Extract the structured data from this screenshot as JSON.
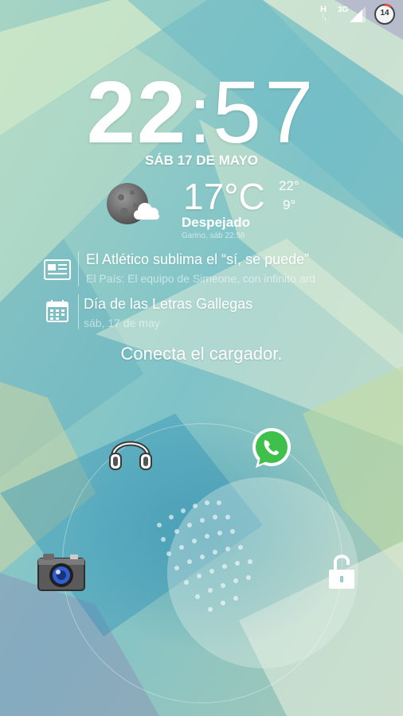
{
  "status_bar": {
    "network_type": "H",
    "mobile_data": "3G",
    "battery_level": "14"
  },
  "clock": {
    "hours": "22",
    "minutes": "57"
  },
  "date": "SÁB 17 DE MAYO",
  "weather": {
    "icon": "night-cloud-moon-icon",
    "temperature": "17°C",
    "high": "22°",
    "low": "9°",
    "condition": "Despejado",
    "location_time": "Garino, sáb 22:56"
  },
  "notifications": [
    {
      "icon": "newspaper-icon",
      "title": "El Atlético sublima el “sí, se puede”",
      "subtitle": "El País: El equipo de Simeone, con infinito ard"
    },
    {
      "icon": "calendar-icon",
      "title": "Día de las Letras Gallegas",
      "subtitle": "sáb, 17 de may"
    }
  ],
  "charger_message": "Conecta el cargador.",
  "lock_targets": [
    "headphones-icon",
    "whatsapp-icon",
    "camera-icon",
    "unlock-icon"
  ],
  "colors": {
    "wallpaper_teal": "#5fb3bd",
    "wallpaper_mint": "#bfe3c9",
    "whatsapp_green": "#3fc04a"
  }
}
